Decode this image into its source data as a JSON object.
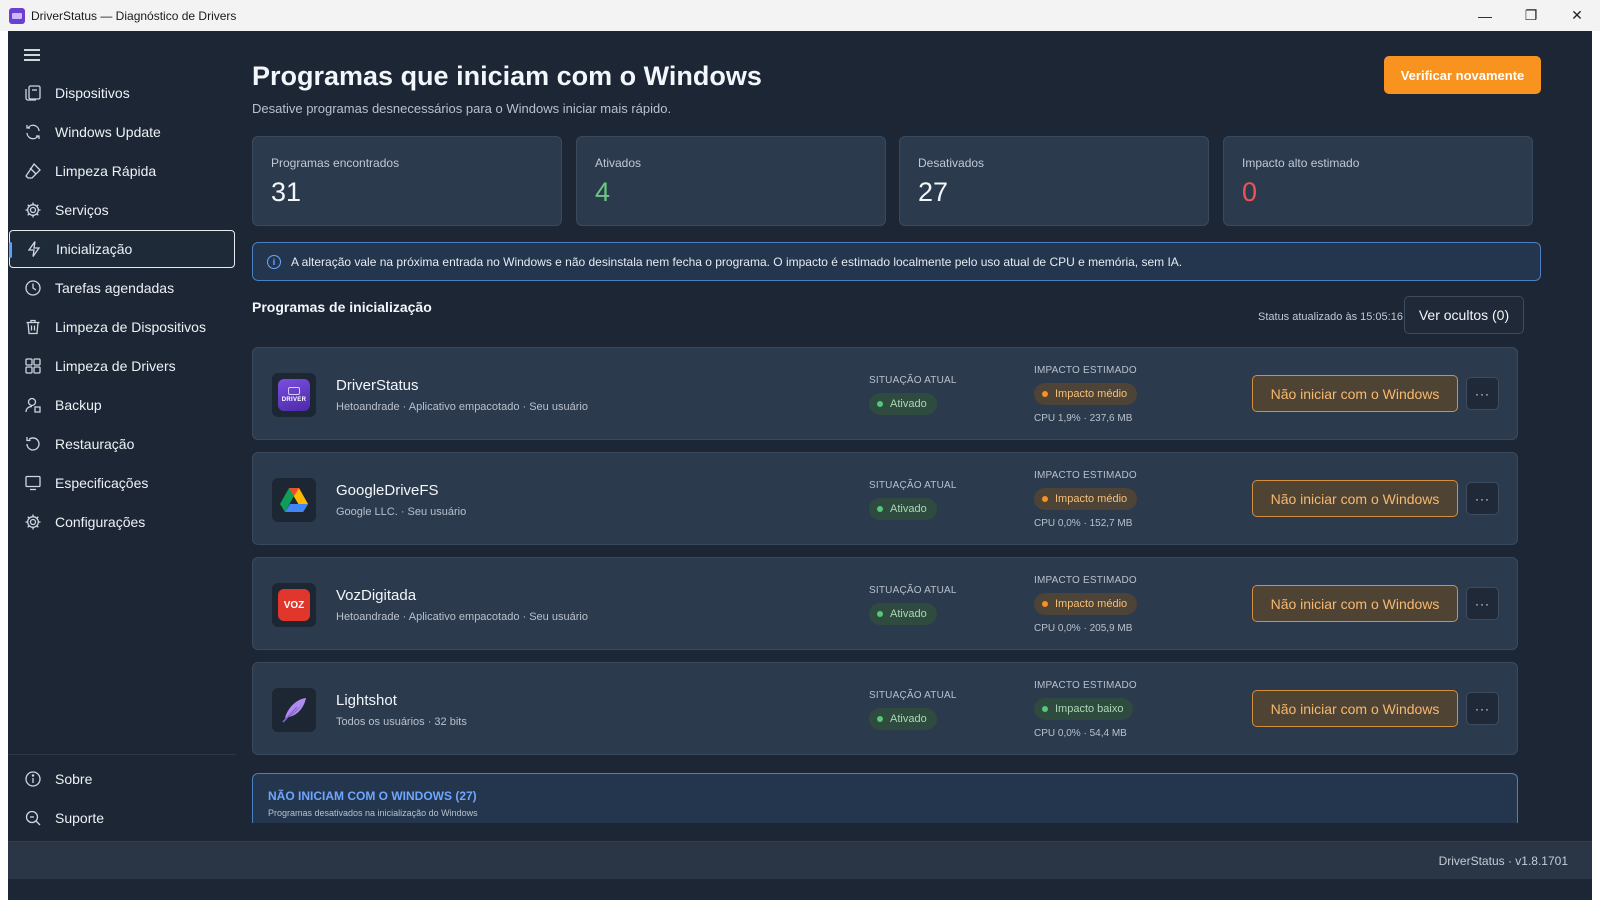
{
  "window": {
    "title": "DriverStatus — Diagnóstico de Drivers",
    "controls": {
      "minimize": "—",
      "maximize": "❐",
      "close": "✕"
    }
  },
  "sidebar": {
    "items": [
      {
        "label": "Dispositivos",
        "icon": "devices-icon"
      },
      {
        "label": "Windows Update",
        "icon": "refresh-icon"
      },
      {
        "label": "Limpeza Rápida",
        "icon": "eraser-icon"
      },
      {
        "label": "Serviços",
        "icon": "gear-icon"
      },
      {
        "label": "Inicialização",
        "icon": "lightning-icon",
        "active": true
      },
      {
        "label": "Tarefas agendadas",
        "icon": "clock-icon"
      },
      {
        "label": "Limpeza de Dispositivos",
        "icon": "trash-icon"
      },
      {
        "label": "Limpeza de Drivers",
        "icon": "grid-icon"
      },
      {
        "label": "Backup",
        "icon": "backup-icon"
      },
      {
        "label": "Restauração",
        "icon": "restore-icon"
      },
      {
        "label": "Especificações",
        "icon": "monitor-icon"
      },
      {
        "label": "Configurações",
        "icon": "gear-icon"
      }
    ],
    "footer_items": [
      {
        "label": "Sobre",
        "icon": "info-icon"
      },
      {
        "label": "Suporte",
        "icon": "support-icon"
      }
    ]
  },
  "header": {
    "title": "Programas que iniciam com o Windows",
    "subtitle": "Desative programas desnecessários para o Windows iniciar mais rápido.",
    "refresh_label": "Verificar novamente"
  },
  "stats": [
    {
      "label": "Programas encontrados",
      "value": "31",
      "color": "#f3f6fa"
    },
    {
      "label": "Ativados",
      "value": "4",
      "color": "#6cc784"
    },
    {
      "label": "Desativados",
      "value": "27",
      "color": "#f3f6fa"
    },
    {
      "label": "Impacto alto estimado",
      "value": "0",
      "color": "#ef5350"
    }
  ],
  "info_text": "A alteração vale na próxima entrada no Windows e não desinstala nem fecha o programa. O impacto é estimado localmente pelo uso atual de CPU e memória, sem IA.",
  "section": {
    "title": "Programas de inicialização",
    "status_time": "Status atualizado às 15:05:16",
    "hidden_label": "Ver ocultos (0)"
  },
  "labels": {
    "situation": "SITUAÇÃO ATUAL",
    "impact": "IMPACTO ESTIMADO",
    "disable_button": "Não iniciar com o Windows",
    "more_button": "···"
  },
  "programs": [
    {
      "name": "DriverStatus",
      "meta": "Hetoandrade · Aplicativo empacotado · Seu usuário",
      "status": "Ativado",
      "impact": "Impacto médio",
      "impact_level": "medium",
      "resources": "CPU 1,9% · 237,6 MB",
      "logo": "driverstatus-logo-icon",
      "logo_text": "DRIVER"
    },
    {
      "name": "GoogleDriveFS",
      "meta": "Google LLC. · Seu usuário",
      "status": "Ativado",
      "impact": "Impacto médio",
      "impact_level": "medium",
      "resources": "CPU 0,0% · 152,7 MB",
      "logo": "google-drive-logo-icon",
      "logo_text": ""
    },
    {
      "name": "VozDigitada",
      "meta": "Hetoandrade · Aplicativo empacotado · Seu usuário",
      "status": "Ativado",
      "impact": "Impacto médio",
      "impact_level": "medium",
      "resources": "CPU 0,0% · 205,9 MB",
      "logo": "vozdigitada-logo-icon",
      "logo_text": "VOZ"
    },
    {
      "name": "Lightshot",
      "meta": "Todos os usuários · 32 bits",
      "status": "Ativado",
      "impact": "Impacto baixo",
      "impact_level": "low",
      "resources": "CPU 0,0% · 54,4 MB",
      "logo": "lightshot-feather-icon",
      "logo_text": ""
    }
  ],
  "disabled_section": {
    "title": "NÃO INICIAM COM O WINDOWS (27)",
    "subtitle": "Programas desativados na inicialização do Windows"
  },
  "footer": {
    "version": "DriverStatus · v1.8.1701"
  }
}
